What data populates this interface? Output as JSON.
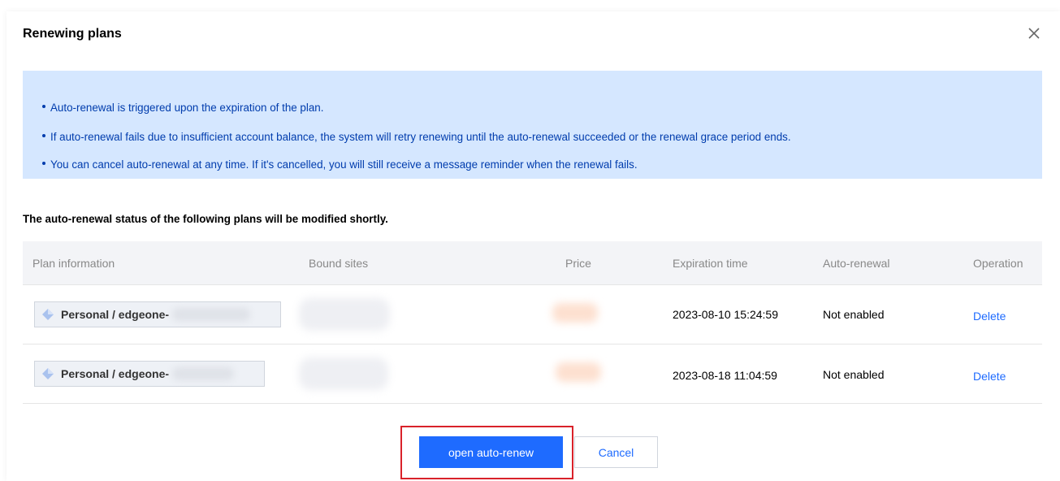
{
  "dialog": {
    "title": "Renewing plans",
    "close_icon": "close-icon"
  },
  "notice": {
    "items": [
      "Auto-renewal is triggered upon the expiration of the plan.",
      "If auto-renewal fails due to insufficient account balance, the system will retry renewing until the auto-renewal succeeded or the renewal grace period ends.",
      "You can cancel auto-renewal at any time. If it's cancelled, you will still receive a message reminder when the renewal fails."
    ]
  },
  "subtitle": "The auto-renewal status of the following plans will be modified shortly.",
  "table": {
    "headers": {
      "plan_information": "Plan information",
      "bound_sites": "Bound sites",
      "price": "Price",
      "expiration_time": "Expiration time",
      "auto_renewal": "Auto-renewal",
      "operation": "Operation"
    },
    "rows": [
      {
        "plan": "Personal / edgeone-",
        "plan_icon": "plan-diamond-icon",
        "expiration_time": "2023-08-10 15:24:59",
        "auto_renewal": "Not enabled",
        "operation": "Delete"
      },
      {
        "plan": "Personal / edgeone-",
        "plan_icon": "plan-diamond-icon",
        "expiration_time": "2023-08-18 11:04:59",
        "auto_renewal": "Not enabled",
        "operation": "Delete"
      }
    ]
  },
  "footer": {
    "confirm_label": "open auto-renew",
    "cancel_label": "Cancel"
  },
  "colors": {
    "accent": "#1e6bff",
    "notice_bg": "#d5e7ff",
    "notice_text": "#003cad",
    "highlight": "#d9222a"
  }
}
